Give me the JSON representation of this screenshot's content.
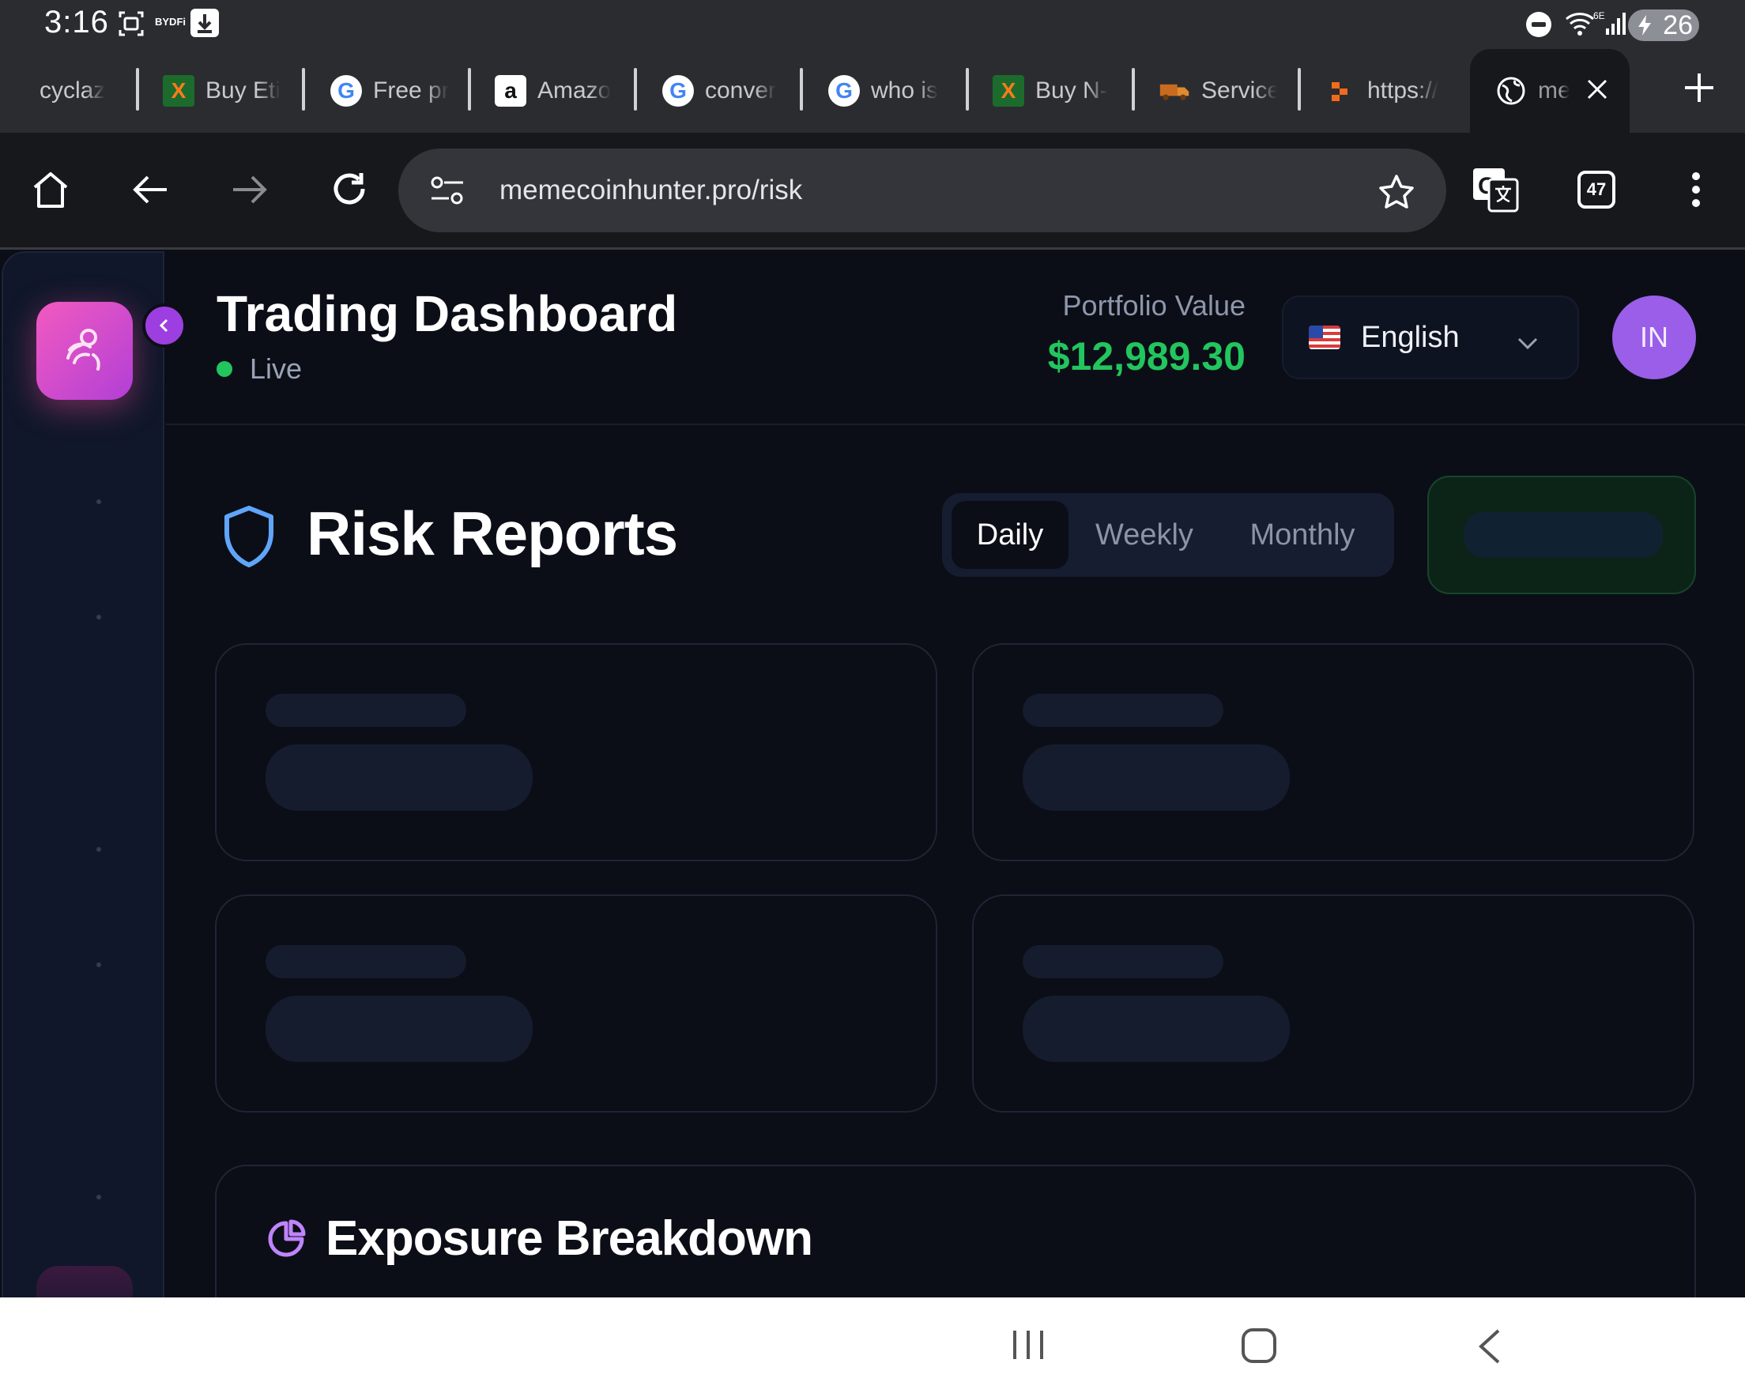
{
  "status_bar": {
    "time": "3:16",
    "small_label": "BYDFi",
    "battery": "26"
  },
  "tabs": [
    {
      "label": "cyclaz",
      "icon": "none"
    },
    {
      "label": "Buy Eti",
      "icon": "x-logo-icon"
    },
    {
      "label": "Free pr",
      "icon": "google-icon"
    },
    {
      "label": "Amazo",
      "icon": "amazon-icon"
    },
    {
      "label": "conver",
      "icon": "google-icon"
    },
    {
      "label": "who is",
      "icon": "google-icon"
    },
    {
      "label": "Buy N-",
      "icon": "x-logo-icon"
    },
    {
      "label": "Service",
      "icon": "truck-icon"
    },
    {
      "label": "https://",
      "icon": "orange-logo-icon"
    },
    {
      "label": "mer",
      "icon": "globe-icon",
      "active": true
    }
  ],
  "toolbar": {
    "url": "memecoinhunter.pro/risk",
    "tab_count": "47"
  },
  "header": {
    "title": "Trading Dashboard",
    "status": "Live",
    "portfolio_label": "Portfolio Value",
    "portfolio_value": "$12,989.30",
    "language": "English",
    "avatar_initials": "IN"
  },
  "risk_reports": {
    "title": "Risk Reports",
    "periods": [
      "Daily",
      "Weekly",
      "Monthly"
    ],
    "selected_period": "Daily"
  },
  "exposure": {
    "title": "Exposure Breakdown"
  },
  "colors": {
    "accent_green": "#22c55e",
    "accent_purple": "#9a5ee8",
    "logo_pink": "#f25ac0",
    "background": "#0b0e17"
  }
}
